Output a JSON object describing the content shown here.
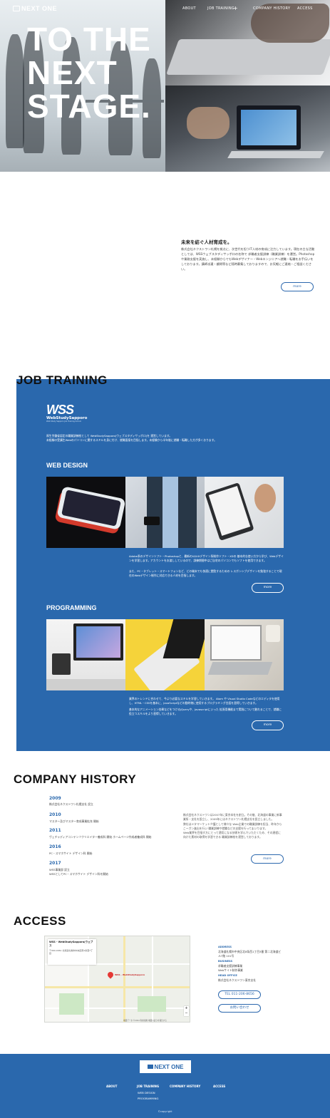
{
  "header": {
    "logo": "NEXT ONE",
    "nav": [
      "ABOUT",
      "JOB TRAINING",
      "COMPANY HISTORY",
      "ACCESS"
    ]
  },
  "hero": {
    "title": "TO THE\nNEXT\nSTAGE."
  },
  "about": {
    "heading": "未来を紡ぐ人材育成を。",
    "body": "株式会社ネクストワン札幌を拠点に、次世代を担うIT人材の育成に注力しています。現在の主な活動としては、WSSウェブスタディサッポロの名称で 求職者支援訓練（職業訓練）を運営。Photoshopや業務支援を実施し、未経験からでもWebデザイナー・Webエンジニアへ就職・転職をお手伝いをしております。講師派遣・顧問等など随時募集しておりますので、お気軽にご連絡・ご相談ください。",
    "more": "more"
  },
  "job_training": {
    "title": "JOB TRAINING",
    "wss_logo": "WSS",
    "wss_name": "WebStudySapporo",
    "wss_tag": "Web Study Sapporo Job Training School",
    "intro": "厚生労働省認定の職業訓練校として WebStudySapporo(ウェブスタディサッポロ)を 運営しています。\n未経験の受講生Webのパソコンに関するスキルを身に付け、就職面接を目指します。未経験から半年後に就職・転職した方が多くおります。",
    "web_design": {
      "title": "WEB DESIGN",
      "desc1": "Adobe系のデザインソフト・Photoshopと、最新のUI/UXデザイン系制作ソフト・XDの 基本的な使い方から学び、Webデザインを学習します。アカウントをお渡ししているので、訓練期間中はご自宅のパソコンでもソフトを使用できます。",
      "desc2": "また、PC・タブレット・スマートフォンなど、どの端末でも快適に閲覧するための レスポンシブデザインを勉強することで現在のWebデザイン制作に対応できる人材を目指します。",
      "more": "more"
    },
    "programming": {
      "title": "PROGRAMMING",
      "desc1": "業界のトレンドに合わせて、今より必要なスキルを学習していきます。 Atom や Visual Studio Codeなどのエディタを使用し、HTML・CSSを基本に、JavaScriptなどの動的物に使用するプログラミング言語を習得していきます。",
      "desc2": "基本的なアニメーション効果などをつけるjQueryや、Javascriptにいった 拡張用機能まで実践について触れることで、就職に役立つスキルをより習得していきます。",
      "more": "more"
    }
  },
  "history": {
    "title": "COMPANY HISTORY",
    "items": [
      {
        "year": "2009",
        "text": "株式会社ネクストワン札幌支社 設立"
      },
      {
        "year": "2010",
        "text": "マスター及びマスター育成事業拡充 開始"
      },
      {
        "year": "2011",
        "text": "ヴェチャディアコンテンツクリエイター養成科 開始 ホームページ作成者養成科 開始"
      },
      {
        "year": "2016",
        "text": "PC・スマホサイト デザイン科 開始"
      },
      {
        "year": "2017",
        "text": "WSS事業部 設立\nWSSとしてPC・スマホサイト デザイン科を開始"
      }
    ],
    "body": "株式会社ネクストワンは2007年に東京本社を創立。その後、北海道の事業に新事業所・支社を設立し、2009年にはネクストワン札幌支社を設立しました。\n弊社はメタマーケット介護として様々な Web企業での職業訓練を担当、昨年からこーガン進出を行い 職業訓練や就職などの支援を行ってまいります。\nWeb業界を目指す方にとって適切になる技術を学んでいただくため、その過程に向けた素材の取得を学習できる 職業訓練校を運営しております。",
    "more": "more"
  },
  "access": {
    "title": "ACCESS",
    "map_title": "WSS - WebStudySapporo(ウェブス",
    "map_addr": "〒060-0061 北海道札幌市中央区南1条西7丁目",
    "map_pin": "WSS - WebStudySapporo",
    "map_foot": "地図データ ©2022 利用規約 地図の誤りを報告する",
    "address_label": "ADDRESS",
    "address": "北海道札幌市中央区北8条西1丁目3番 第二北海道ビル7階 101号",
    "business_label": "BUSINESS",
    "business": "求職者支援訓練事業\nWebサイト制作事業",
    "office_label": "HEAD OFFICE",
    "office": "株式会社ネクストワン東京支社",
    "tel": "TEL 011-206-8656",
    "contact": "お問い合わせ"
  },
  "footer": {
    "logo": "NEXT ONE",
    "nav": [
      "ABOUT",
      "JOB TRAINING",
      "COMPANY HISTORY",
      "ACCESS"
    ],
    "sub": [
      "WEB DESIGN",
      "PROGRAMMING"
    ],
    "copyright": "©copyright"
  },
  "colors": {
    "brand_blue": "#2a68ad",
    "white": "#ffffff"
  }
}
